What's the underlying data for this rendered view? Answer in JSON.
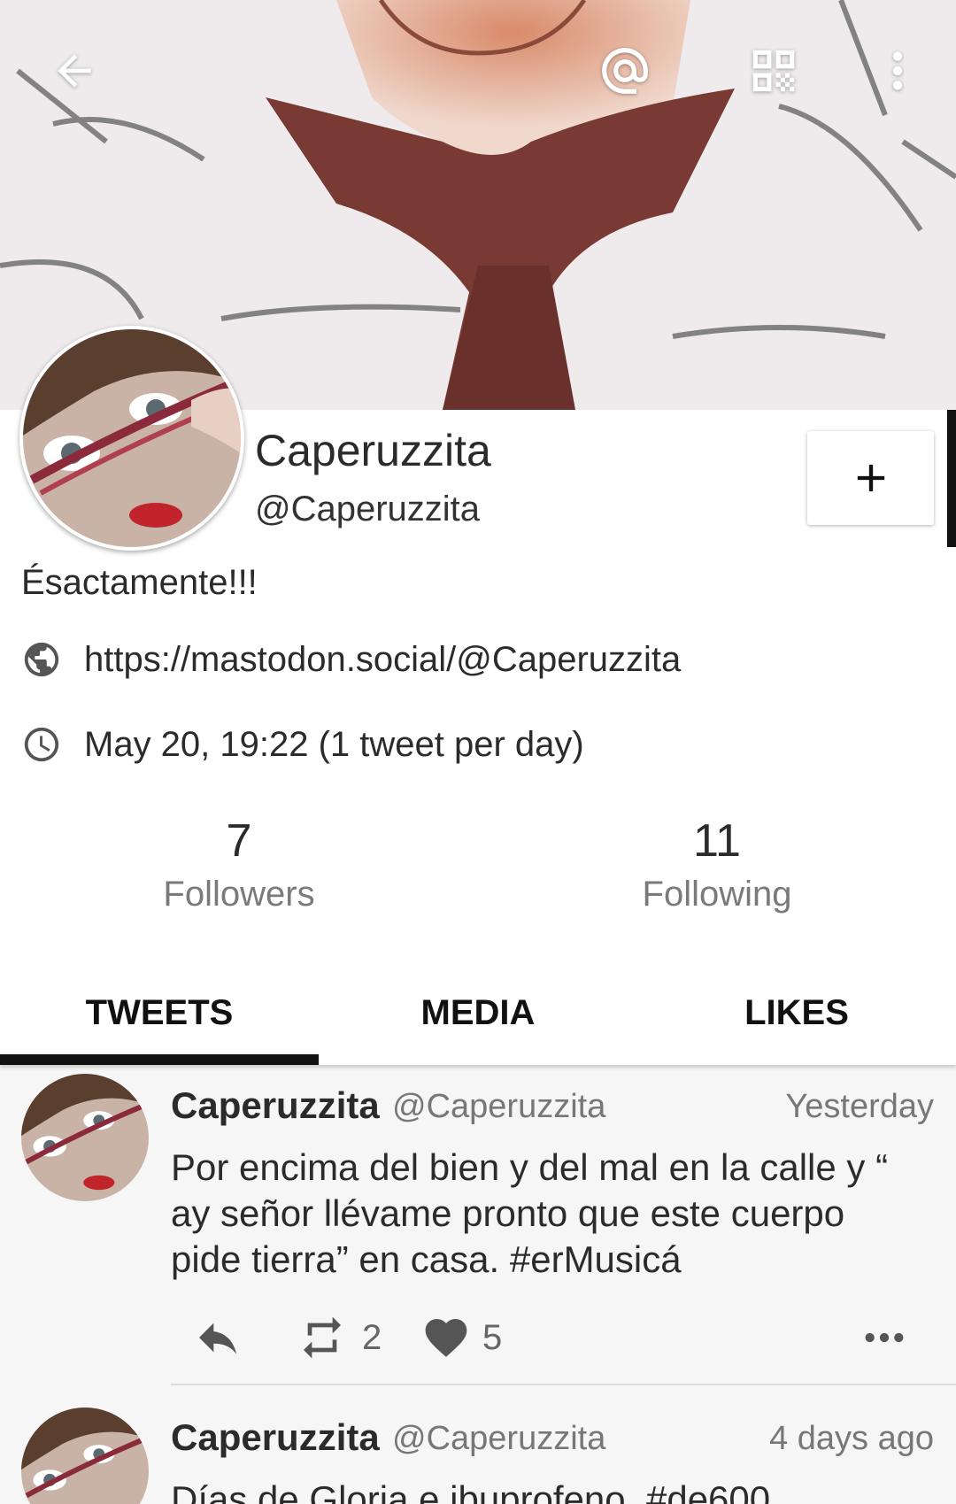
{
  "header": {
    "back_icon": "arrow-left-icon",
    "mention_icon": "at-sign-icon",
    "qr_icon": "qr-code-icon",
    "overflow_icon": "more-vertical-icon"
  },
  "profile": {
    "display_name": "Caperuzzita",
    "handle": "@Caperuzzita",
    "bio": "Ésactamente!!!",
    "url": "https://mastodon.social/@Caperuzzita",
    "joined": "May 20, 19:22 (1 tweet per day)",
    "follow_icon": "plus-icon"
  },
  "stats": {
    "followers_count": "7",
    "followers_label": "Followers",
    "following_count": "11",
    "following_label": "Following"
  },
  "tabs": [
    {
      "label": "TWEETS",
      "active": true
    },
    {
      "label": "MEDIA",
      "active": false
    },
    {
      "label": "LIKES",
      "active": false
    }
  ],
  "tweets": [
    {
      "name": "Caperuzzita",
      "handle": "@Caperuzzita",
      "time": "Yesterday",
      "text": "Por encima del bien y del mal en la calle y “ ay señor llévame pronto que este cuerpo pide tierra” en casa. #erMusicá",
      "retweets": "2",
      "likes": "5"
    },
    {
      "name": "Caperuzzita",
      "handle": "@Caperuzzita",
      "time": "4 days ago",
      "text": "Días de Gloria e ibuprofeno. #de600"
    }
  ],
  "colors": {
    "accent": "#111111",
    "text": "#2b2b2b",
    "muted": "#777777",
    "timeline_bg": "#f6f6f6"
  }
}
